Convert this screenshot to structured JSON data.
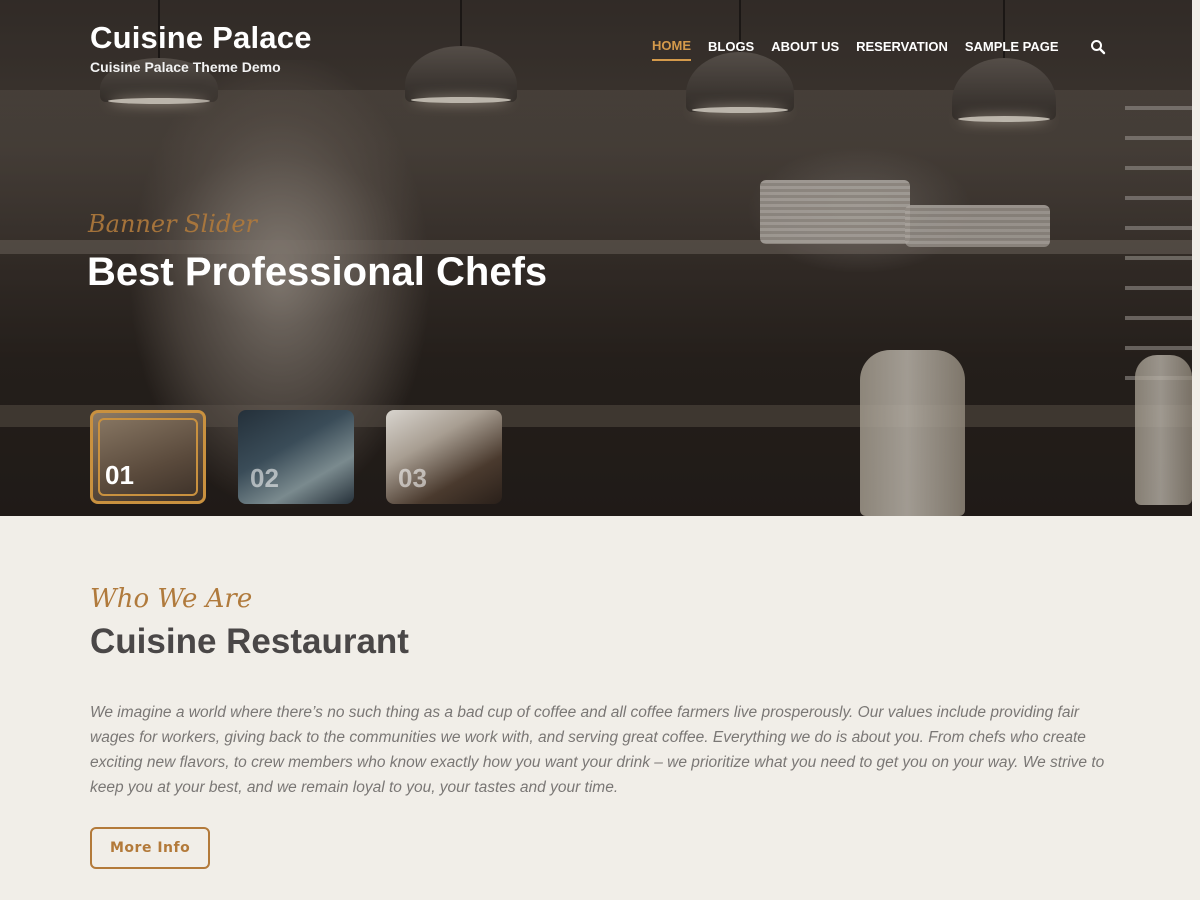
{
  "header": {
    "site_title": "Cuisine Palace",
    "tagline": "Cuisine Palace Theme Demo",
    "nav": [
      {
        "label": "HOME",
        "active": true
      },
      {
        "label": "BLOGS",
        "active": false
      },
      {
        "label": "ABOUT US",
        "active": false
      },
      {
        "label": "RESERVATION",
        "active": false
      },
      {
        "label": "SAMPLE PAGE",
        "active": false
      }
    ],
    "search_icon": "search-icon"
  },
  "hero": {
    "eyebrow": "Banner Slider",
    "title": "Best Professional Chefs",
    "thumbnails": [
      {
        "number": "01",
        "active": true
      },
      {
        "number": "02",
        "active": false
      },
      {
        "number": "03",
        "active": false
      }
    ]
  },
  "about": {
    "eyebrow": "Who We Are",
    "heading": "Cuisine Restaurant",
    "body": "We imagine a world where there’s no such thing as a bad cup of coffee and all coffee farmers live prosperously. Our values include providing fair wages for workers, giving back to the communities we work with, and serving great coffee. Everything we do is about you. From chefs who create exciting new flavors, to crew members who know exactly how you want your drink – we prioritize what you need to get you on your way. We strive to keep you at your best, and we remain loyal to you, your tastes and your time.",
    "button_label": "More Info"
  },
  "colors": {
    "accent": "#d49a4b",
    "button_border": "#b37a3a",
    "page_background": "#f1eee8",
    "heading": "#4a4747"
  }
}
